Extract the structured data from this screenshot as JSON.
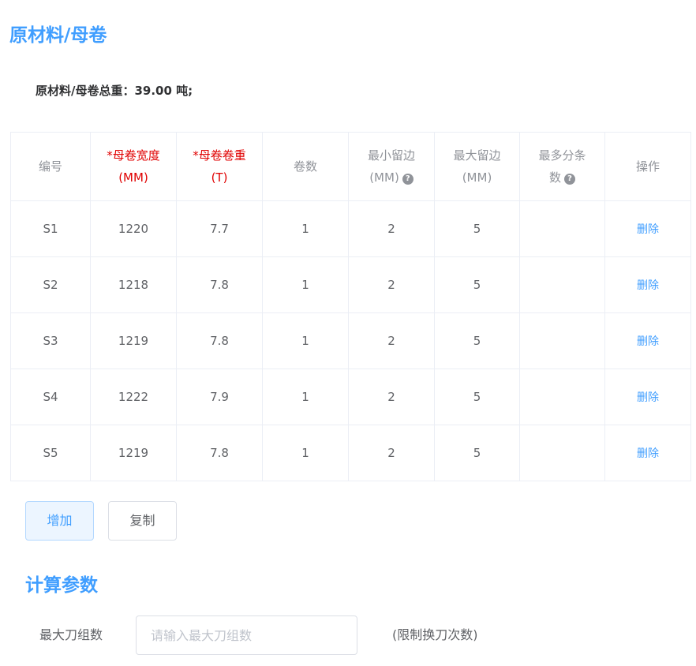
{
  "raw_material": {
    "title": "原材料/母卷",
    "total_weight_text": "原材料/母卷总重：39.00 吨;"
  },
  "table": {
    "headers": [
      {
        "line1": "编号",
        "line2": "",
        "required": false,
        "help": false
      },
      {
        "line1": "*母卷宽度",
        "line2": "(MM)",
        "required": true,
        "help": false
      },
      {
        "line1": "*母卷卷重",
        "line2": "(T)",
        "required": true,
        "help": false
      },
      {
        "line1": "卷数",
        "line2": "",
        "required": false,
        "help": false
      },
      {
        "line1": "最小留边",
        "line2": "(MM)",
        "required": false,
        "help": true
      },
      {
        "line1": "最大留边",
        "line2": "(MM)",
        "required": false,
        "help": false
      },
      {
        "line1": "最多分条",
        "line2": "数",
        "required": false,
        "help": true
      },
      {
        "line1": "操作",
        "line2": "",
        "required": false,
        "help": false
      }
    ],
    "help_icon": "?",
    "delete_label": "删除",
    "rows": [
      {
        "id": "S1",
        "width": "1220",
        "weight": "7.7",
        "count": "1",
        "min_edge": "2",
        "max_edge": "5",
        "max_strips": ""
      },
      {
        "id": "S2",
        "width": "1218",
        "weight": "7.8",
        "count": "1",
        "min_edge": "2",
        "max_edge": "5",
        "max_strips": ""
      },
      {
        "id": "S3",
        "width": "1219",
        "weight": "7.8",
        "count": "1",
        "min_edge": "2",
        "max_edge": "5",
        "max_strips": ""
      },
      {
        "id": "S4",
        "width": "1222",
        "weight": "7.9",
        "count": "1",
        "min_edge": "2",
        "max_edge": "5",
        "max_strips": ""
      },
      {
        "id": "S5",
        "width": "1219",
        "weight": "7.8",
        "count": "1",
        "min_edge": "2",
        "max_edge": "5",
        "max_strips": ""
      }
    ]
  },
  "buttons": {
    "add_label": "增加",
    "copy_label": "复制"
  },
  "calc": {
    "title": "计算参数",
    "max_knife_label": "最大刀组数",
    "max_knife_value": "",
    "max_knife_placeholder": "请输入最大刀组数",
    "max_knife_hint": "(限制换刀次数)"
  },
  "colors": {
    "accent": "#409eff",
    "required": "#e00000",
    "header_text": "#909399",
    "body_text": "#606266",
    "border": "#ebeef5"
  },
  "icons": {
    "help": "question-circle-icon"
  }
}
